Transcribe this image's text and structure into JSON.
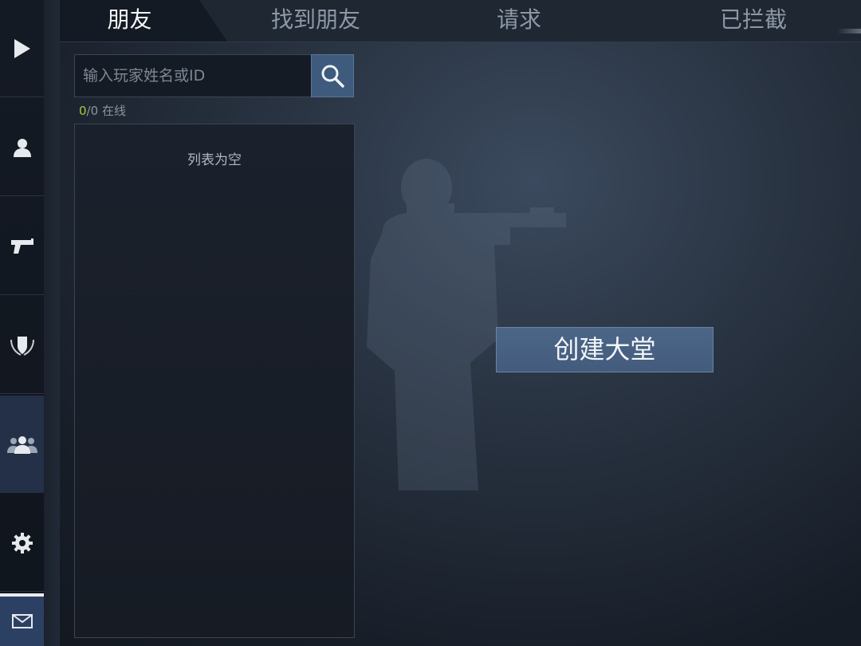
{
  "tabs": [
    {
      "label": "朋友",
      "active": true
    },
    {
      "label": "找到朋友",
      "active": false
    },
    {
      "label": "请求",
      "active": false
    },
    {
      "label": "已拦截",
      "active": false
    }
  ],
  "sidebar": {
    "items": [
      {
        "icon": "play-icon"
      },
      {
        "icon": "profile-icon"
      },
      {
        "icon": "pistol-icon"
      },
      {
        "icon": "rank-shield-icon"
      },
      {
        "icon": "friends-icon",
        "active": true
      },
      {
        "icon": "gear-icon"
      },
      {
        "icon": "mail-icon"
      }
    ]
  },
  "search": {
    "placeholder": "输入玩家姓名或ID",
    "value": "",
    "icon": "search-icon"
  },
  "online_status": {
    "online": "0",
    "separator": "/",
    "total": "0",
    "label": "在线"
  },
  "friend_list": {
    "empty_text": "列表为空"
  },
  "create_lobby_label": "创建大堂",
  "colors": {
    "accent_button": "#455f82",
    "online_count": "#a8c93a",
    "active_tab_text": "#f4f6f8"
  }
}
